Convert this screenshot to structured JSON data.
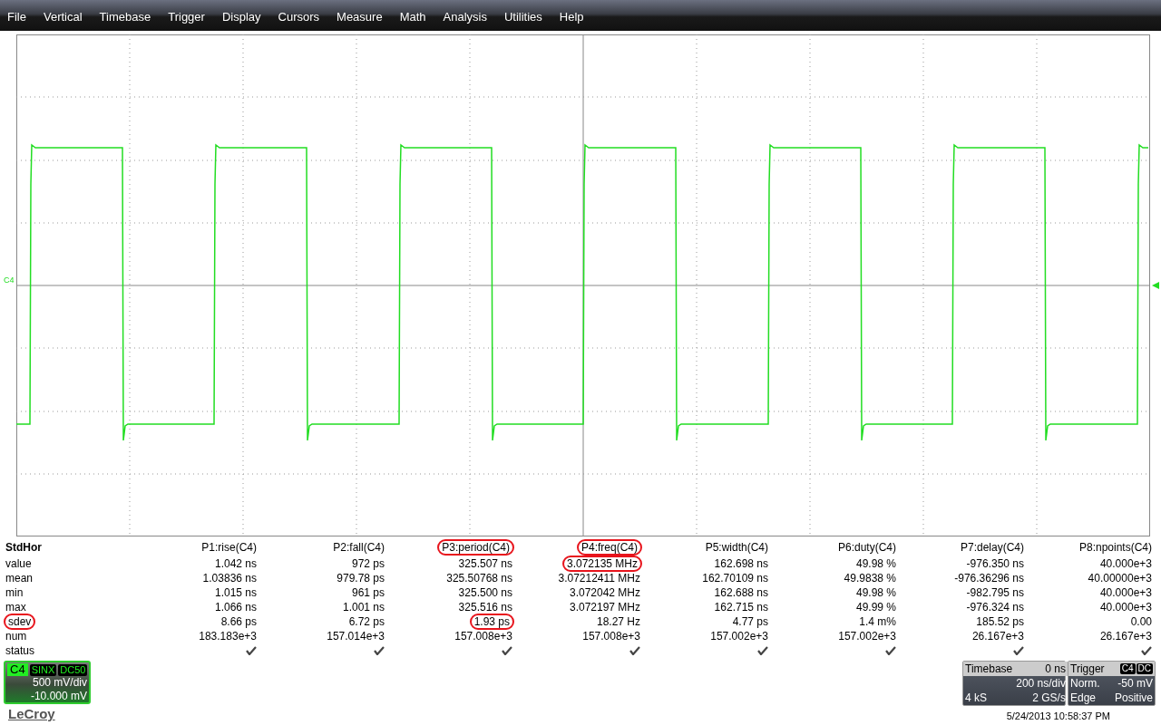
{
  "menu": [
    "File",
    "Vertical",
    "Timebase",
    "Trigger",
    "Display",
    "Cursors",
    "Measure",
    "Math",
    "Analysis",
    "Utilities",
    "Help"
  ],
  "display": {
    "channel_label": "C4"
  },
  "measurements": {
    "title": "StdHor",
    "columns": [
      {
        "label": "P1:rise(C4)",
        "highlighted": false
      },
      {
        "label": "P2:fall(C4)",
        "highlighted": false
      },
      {
        "label": "P3:period(C4)",
        "highlighted": true
      },
      {
        "label": "P4:freq(C4)",
        "highlighted": true
      },
      {
        "label": "P5:width(C4)",
        "highlighted": false
      },
      {
        "label": "P6:duty(C4)",
        "highlighted": false
      },
      {
        "label": "P7:delay(C4)",
        "highlighted": false
      },
      {
        "label": "P8:npoints(C4)",
        "highlighted": false
      }
    ],
    "rows": [
      {
        "kind": "values",
        "label": "value",
        "highlighted": false,
        "cells": [
          {
            "text": "1.042 ns",
            "highlighted": false
          },
          {
            "text": "972 ps",
            "highlighted": false
          },
          {
            "text": "325.507 ns",
            "highlighted": false
          },
          {
            "text": "3.072135 MHz",
            "highlighted": true
          },
          {
            "text": "162.698 ns",
            "highlighted": false
          },
          {
            "text": "49.98 %",
            "highlighted": false
          },
          {
            "text": "-976.350 ns",
            "highlighted": false
          },
          {
            "text": "40.000e+3",
            "highlighted": false
          }
        ]
      },
      {
        "kind": "values",
        "label": "mean",
        "highlighted": false,
        "cells": [
          {
            "text": "1.03836 ns",
            "highlighted": false
          },
          {
            "text": "979.78 ps",
            "highlighted": false
          },
          {
            "text": "325.50768 ns",
            "highlighted": false
          },
          {
            "text": "3.07212411 MHz",
            "highlighted": false
          },
          {
            "text": "162.70109 ns",
            "highlighted": false
          },
          {
            "text": "49.9838 %",
            "highlighted": false
          },
          {
            "text": "-976.36296 ns",
            "highlighted": false
          },
          {
            "text": "40.00000e+3",
            "highlighted": false
          }
        ]
      },
      {
        "kind": "values",
        "label": "min",
        "highlighted": false,
        "cells": [
          {
            "text": "1.015 ns",
            "highlighted": false
          },
          {
            "text": "961 ps",
            "highlighted": false
          },
          {
            "text": "325.500 ns",
            "highlighted": false
          },
          {
            "text": "3.072042 MHz",
            "highlighted": false
          },
          {
            "text": "162.688 ns",
            "highlighted": false
          },
          {
            "text": "49.98 %",
            "highlighted": false
          },
          {
            "text": "-982.795 ns",
            "highlighted": false
          },
          {
            "text": "40.000e+3",
            "highlighted": false
          }
        ]
      },
      {
        "kind": "values",
        "label": "max",
        "highlighted": false,
        "cells": [
          {
            "text": "1.066 ns",
            "highlighted": false
          },
          {
            "text": "1.001 ns",
            "highlighted": false
          },
          {
            "text": "325.516 ns",
            "highlighted": false
          },
          {
            "text": "3.072197 MHz",
            "highlighted": false
          },
          {
            "text": "162.715 ns",
            "highlighted": false
          },
          {
            "text": "49.99 %",
            "highlighted": false
          },
          {
            "text": "-976.324 ns",
            "highlighted": false
          },
          {
            "text": "40.000e+3",
            "highlighted": false
          }
        ]
      },
      {
        "kind": "values",
        "label": "sdev",
        "highlighted": true,
        "cells": [
          {
            "text": "8.66 ps",
            "highlighted": false
          },
          {
            "text": "6.72 ps",
            "highlighted": false
          },
          {
            "text": "1.93 ps",
            "highlighted": true
          },
          {
            "text": "18.27 Hz",
            "highlighted": false
          },
          {
            "text": "4.77 ps",
            "highlighted": false
          },
          {
            "text": "1.4 m%",
            "highlighted": false
          },
          {
            "text": "185.52 ps",
            "highlighted": false
          },
          {
            "text": "0.00",
            "highlighted": false
          }
        ]
      },
      {
        "kind": "values",
        "label": "num",
        "highlighted": false,
        "cells": [
          {
            "text": "183.183e+3",
            "highlighted": false
          },
          {
            "text": "157.014e+3",
            "highlighted": false
          },
          {
            "text": "157.008e+3",
            "highlighted": false
          },
          {
            "text": "157.008e+3",
            "highlighted": false
          },
          {
            "text": "157.002e+3",
            "highlighted": false
          },
          {
            "text": "157.002e+3",
            "highlighted": false
          },
          {
            "text": "26.167e+3",
            "highlighted": false
          },
          {
            "text": "26.167e+3",
            "highlighted": false
          }
        ]
      },
      {
        "kind": "status",
        "label": "status",
        "highlighted": false,
        "cells": [
          {
            "ok": true
          },
          {
            "ok": true
          },
          {
            "ok": true
          },
          {
            "ok": true
          },
          {
            "ok": true
          },
          {
            "ok": true
          },
          {
            "ok": true
          },
          {
            "ok": true
          }
        ]
      }
    ]
  },
  "channel": {
    "name": "C4",
    "tags": [
      "SINX",
      "DC50"
    ],
    "scale": "500 mV/div",
    "offset": "-10.000 mV"
  },
  "logo": "LeCroy",
  "timebase": {
    "title": "Timebase",
    "delay": "0 ns",
    "scale": "200 ns/div",
    "samples": "4 kS",
    "rate": "2 GS/s"
  },
  "trigger": {
    "title": "Trigger",
    "tags": [
      "C4",
      "DC"
    ],
    "mode": "Norm.",
    "level": "-50 mV",
    "type": "Edge",
    "slope": "Positive"
  },
  "timestamp": "5/24/2013 10:58:37 PM"
}
